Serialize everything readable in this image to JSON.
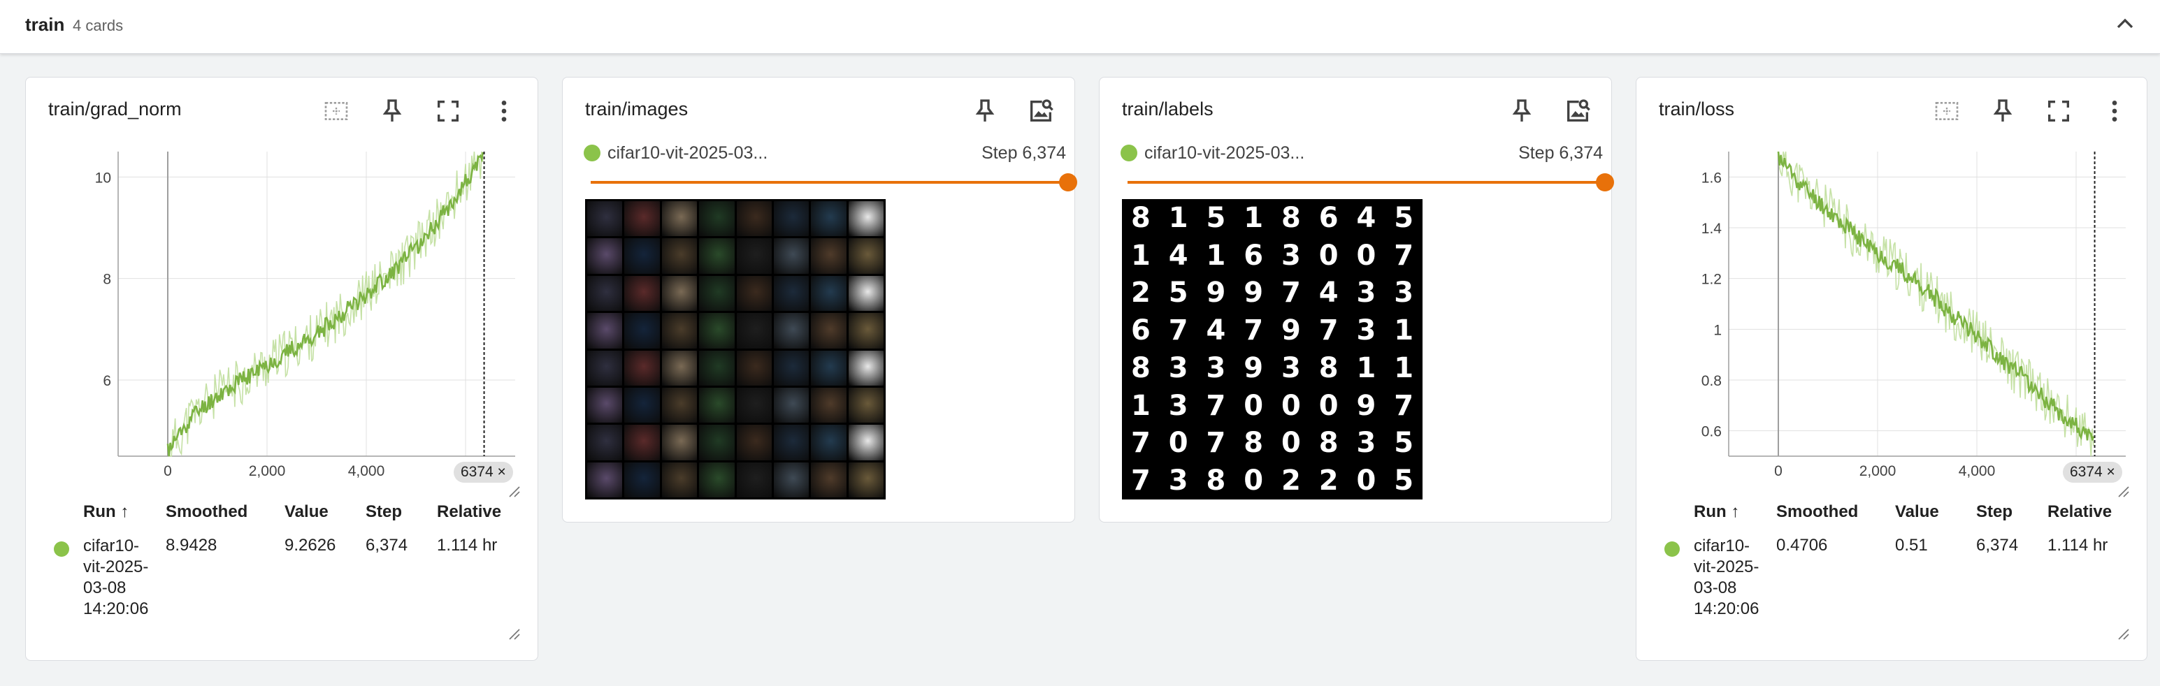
{
  "group": {
    "title": "train",
    "count": "4 cards"
  },
  "cards": {
    "grad_norm": {
      "title": "train/grad_norm",
      "step_chip": "6374 ×",
      "table": {
        "headers": [
          "Run ↑",
          "Smoothed",
          "Value",
          "Step",
          "Relative"
        ],
        "run_lines": [
          "cifar10-",
          "vit-2025-",
          "03-08",
          "14:20:06"
        ],
        "smoothed": "8.9428",
        "value": "9.2626",
        "step": "6,374",
        "relative": "1.114 hr"
      }
    },
    "images": {
      "title": "train/images",
      "run": "cifar10-vit-2025-03...",
      "step": "Step 6,374"
    },
    "labels": {
      "title": "train/labels",
      "run": "cifar10-vit-2025-03...",
      "step": "Step 6,374",
      "digits": [
        "8",
        "1",
        "5",
        "1",
        "8",
        "6",
        "4",
        "5",
        "1",
        "4",
        "1",
        "6",
        "3",
        "0",
        "0",
        "7",
        "2",
        "5",
        "9",
        "9",
        "7",
        "4",
        "3",
        "3",
        "6",
        "7",
        "4",
        "7",
        "9",
        "7",
        "3",
        "1",
        "8",
        "3",
        "3",
        "9",
        "3",
        "8",
        "1",
        "1",
        "1",
        "3",
        "7",
        "0",
        "0",
        "0",
        "9",
        "7",
        "7",
        "0",
        "7",
        "8",
        "0",
        "8",
        "3",
        "5",
        "7",
        "3",
        "8",
        "0",
        "2",
        "2",
        "0",
        "5"
      ]
    },
    "loss": {
      "title": "train/loss",
      "step_chip": "6374 ×",
      "table": {
        "headers": [
          "Run ↑",
          "Smoothed",
          "Value",
          "Step",
          "Relative"
        ],
        "run_lines": [
          "cifar10-",
          "vit-2025-",
          "03-08",
          "14:20:06"
        ],
        "smoothed": "0.4706",
        "value": "0.51",
        "step": "6,374",
        "relative": "1.114 hr"
      }
    }
  },
  "colors": {
    "series": "#7cb342",
    "series_light": "#c5e1a5",
    "slider": "#e8710a",
    "run_dot": "#8bc34a"
  },
  "icons": [
    "fit-domain-icon",
    "pin-icon",
    "fullscreen-icon",
    "more-vert-icon",
    "image-search-icon",
    "chevron-up-icon",
    "resize-handle-icon"
  ],
  "chart_data": [
    {
      "type": "line",
      "title": "train/grad_norm",
      "x_ticks": [
        "0",
        "2,000",
        "4,000",
        "6"
      ],
      "y_ticks": [
        "6",
        "8",
        "10"
      ],
      "xlim": [
        -1000,
        7000
      ],
      "ylim": [
        4.5,
        10.5
      ],
      "x": [
        0,
        500,
        1000,
        1500,
        2000,
        2500,
        3000,
        3500,
        4000,
        4500,
        5000,
        5500,
        6000,
        6374
      ],
      "series": [
        {
          "values": [
            4.6,
            5.3,
            5.7,
            6.0,
            6.3,
            6.6,
            6.9,
            7.3,
            7.7,
            8.1,
            8.6,
            9.2,
            9.9,
            10.4
          ]
        }
      ],
      "step_marker": 6374
    },
    {
      "type": "line",
      "title": "train/loss",
      "x_ticks": [
        "0",
        "2,000",
        "4,000",
        "6"
      ],
      "y_ticks": [
        "0.6",
        "0.8",
        "1",
        "1.2",
        "1.4",
        "1.6"
      ],
      "xlim": [
        -1000,
        7000
      ],
      "ylim": [
        0.5,
        1.7
      ],
      "x": [
        0,
        500,
        1000,
        1500,
        2000,
        2500,
        3000,
        3500,
        4000,
        4500,
        5000,
        5500,
        6000,
        6374
      ],
      "series": [
        {
          "values": [
            1.68,
            1.56,
            1.47,
            1.38,
            1.3,
            1.23,
            1.15,
            1.06,
            0.98,
            0.88,
            0.8,
            0.7,
            0.62,
            0.55
          ]
        }
      ],
      "step_marker": 6374
    }
  ]
}
